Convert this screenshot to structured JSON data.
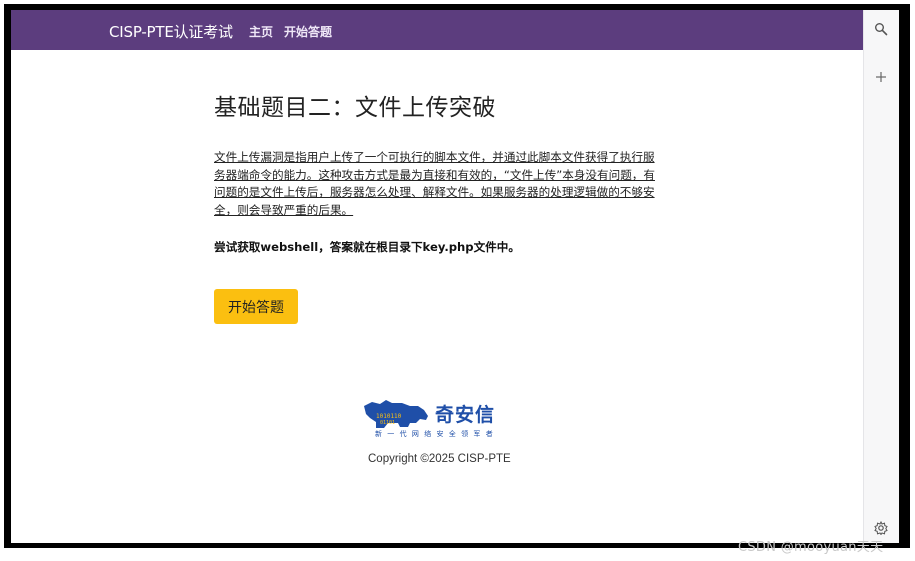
{
  "navbar": {
    "brand": "CISP-PTE认证考试",
    "links": [
      "主页",
      "开始答题"
    ],
    "color": "#5c3d7e"
  },
  "main": {
    "title": "基础题目二：文件上传突破",
    "description": "文件上传漏洞是指用户上传了一个可执行的脚本文件，并通过此脚本文件获得了执行服务器端命令的能力。这种攻击方式是最为直接和有效的，“文件上传”本身没有问题，有问题的是文件上传后，服务器怎么处理、解释文件。如果服务器的处理逻辑做的不够安全，则会导致严重的后果。",
    "task": "尝试获取webshell，答案就在根目录下key.php文件中。",
    "start_button": "开始答题",
    "start_button_color": "#fbbf10"
  },
  "footer": {
    "logo_text": "奇安信",
    "logo_slogan": "新一代网络安全领军者",
    "copyright": "Copyright ©2025 CISP-PTE"
  },
  "sidebar": {
    "icons": [
      "search-icon",
      "plus-icon",
      "gear-icon"
    ]
  },
  "watermark": "CSDN @mooyuan天天"
}
